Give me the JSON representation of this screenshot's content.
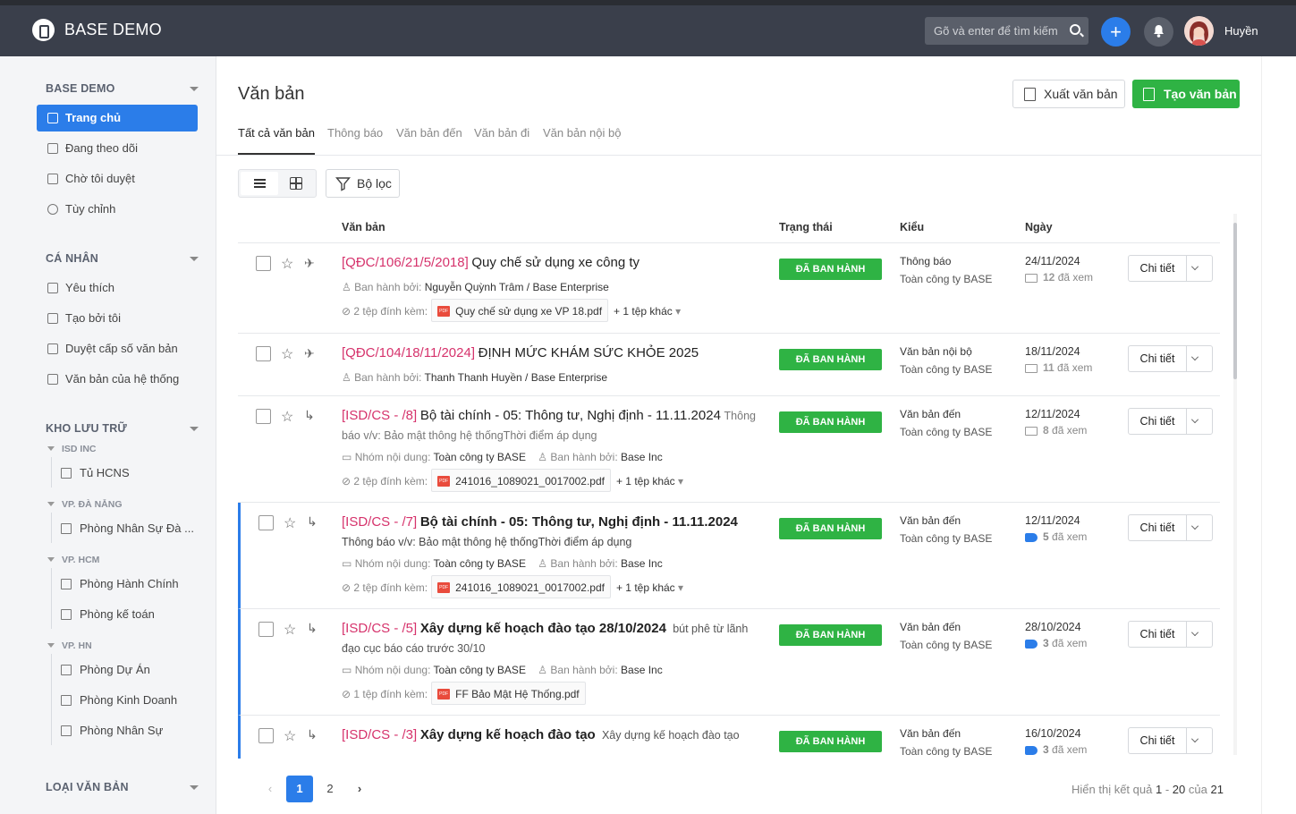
{
  "app": {
    "brand": "BASE DEMO",
    "search_placeholder": "Gõ và enter để tìm kiếm",
    "user": "Huyền"
  },
  "sidebar": {
    "sec1": "BASE DEMO",
    "items1": [
      "Trang chủ",
      "Đang theo dõi",
      "Chờ tôi duyệt",
      "Tùy chỉnh"
    ],
    "sec2": "CÁ NHÂN",
    "items2": [
      "Yêu thích",
      "Tạo bởi tôi",
      "Duyệt cấp số văn bản",
      "Văn bản của hệ thống"
    ],
    "sec3": "KHO LƯU TRỮ",
    "groups": [
      {
        "name": "ISD INC",
        "leaves": [
          "Tủ HCNS"
        ]
      },
      {
        "name": "VP. ĐÀ NẴNG",
        "leaves": [
          "Phòng Nhân Sự Đà ..."
        ]
      },
      {
        "name": "VP. HCM",
        "leaves": [
          "Phòng Hành Chính",
          "Phòng kế toán"
        ]
      },
      {
        "name": "VP. HN",
        "leaves": [
          "Phòng Dự Án",
          "Phòng Kinh Doanh",
          "Phòng Nhân Sự"
        ]
      }
    ],
    "sec4": "LOẠI VĂN BẢN"
  },
  "page": {
    "title": "Văn bản",
    "export": "Xuất văn bản",
    "create": "Tạo văn bản",
    "filter": "Bộ lọc",
    "tabs": [
      "Tất cả văn bản",
      "Thông báo",
      "Văn bản đến",
      "Văn bản đi",
      "Văn bản nội bộ"
    ]
  },
  "table": {
    "headers": [
      "Văn bản",
      "Trạng thái",
      "Kiểu",
      "Ngày"
    ],
    "rows": [
      {
        "code": "[QĐC/106/21/5/2018]",
        "title": "Quy chế sử dụng xe công ty",
        "excerpt": "",
        "issuer_label": "Ban hành bởi:",
        "issuer": "Nguyễn Quỳnh Trâm / Base Enterprise",
        "attach_label": "2 tệp đính kèm:",
        "file": "Quy chế sử dụng xe VP 18.pdf",
        "more": "+ 1 tệp khác",
        "status": "ĐÃ BAN HÀNH",
        "kind": "Thông báo",
        "scope": "Toàn công ty BASE",
        "date": "24/11/2024",
        "views": "12",
        "views_label": "đã xem"
      },
      {
        "code": "[QĐC/104/18/11/2024]",
        "title": "ĐỊNH MỨC KHÁM SỨC KHỎE 2025",
        "excerpt": "",
        "issuer_label": "Ban hành bởi:",
        "issuer": "Thanh Thanh Huyền / Base Enterprise",
        "status": "ĐÃ BAN HÀNH",
        "kind": "Văn bản nội bộ",
        "scope": "Toàn công ty BASE",
        "date": "18/11/2024",
        "views": "11",
        "views_label": "đã xem"
      },
      {
        "code": "[ISD/CS - /8]",
        "title": "Bộ tài chính - 05: Thông tư, Nghị định - 11.11.2024",
        "excerpt": "Thông báo v/v: Bảo mật thông hệ thốngThời điểm áp dụng",
        "group_label": "Nhóm nội dung:",
        "group": "Toàn công ty BASE",
        "issuer_label": "Ban hành bởi:",
        "issuer": "Base Inc",
        "attach_label": "2 tệp đính kèm:",
        "file": "241016_1089021_0017002.pdf",
        "more": "+ 1 tệp khác",
        "status": "ĐÃ BAN HÀNH",
        "kind": "Văn bản đến",
        "scope": "Toàn công ty BASE",
        "date": "12/11/2024",
        "views": "8",
        "views_label": "đã xem"
      },
      {
        "code": "[ISD/CS - /7]",
        "title": "Bộ tài chính - 05: Thông tư, Nghị định - 11.11.2024",
        "excerpt": "Thông báo v/v: Bảo mật thông hệ thốngThời điểm áp dụng",
        "group_label": "Nhóm nội dung:",
        "group": "Toàn công ty BASE",
        "issuer_label": "Ban hành bởi:",
        "issuer": "Base Inc",
        "attach_label": "2 tệp đính kèm:",
        "file": "241016_1089021_0017002.pdf",
        "more": "+ 1 tệp khác",
        "status": "ĐÃ BAN HÀNH",
        "kind": "Văn bản đến",
        "scope": "Toàn công ty BASE",
        "date": "12/11/2024",
        "views": "5",
        "views_label": "đã xem"
      },
      {
        "code": "[ISD/CS - /5]",
        "title": "Xây dựng kế hoạch đào tạo 28/10/2024",
        "excerpt": "bút phê từ lãnh đạo cục báo cáo trước 30/10",
        "group_label": "Nhóm nội dung:",
        "group": "Toàn công ty BASE",
        "issuer_label": "Ban hành bởi:",
        "issuer": "Base Inc",
        "attach_label": "1 tệp đính kèm:",
        "file": "FF Bảo Mật Hệ Thống.pdf",
        "status": "ĐÃ BAN HÀNH",
        "kind": "Văn bản đến",
        "scope": "Toàn công ty BASE",
        "date": "28/10/2024",
        "views": "3",
        "views_label": "đã xem"
      },
      {
        "code": "[ISD/CS - /3]",
        "title": "Xây dựng kế hoạch đào tạo",
        "excerpt": "Xây dựng kế hoạch đào tạo",
        "status": "ĐÃ BAN HÀNH",
        "kind": "Văn bản đến",
        "scope": "Toàn công ty BASE",
        "date": "16/10/2024",
        "views": "3",
        "views_label": "đã xem"
      }
    ],
    "detail": "Chi tiết"
  },
  "pagination": {
    "pages": [
      "1",
      "2"
    ],
    "result_prefix": "Hiển thị kết quả",
    "from": "1",
    "sep": "-",
    "to": "20",
    "of": "của",
    "total": "21"
  }
}
